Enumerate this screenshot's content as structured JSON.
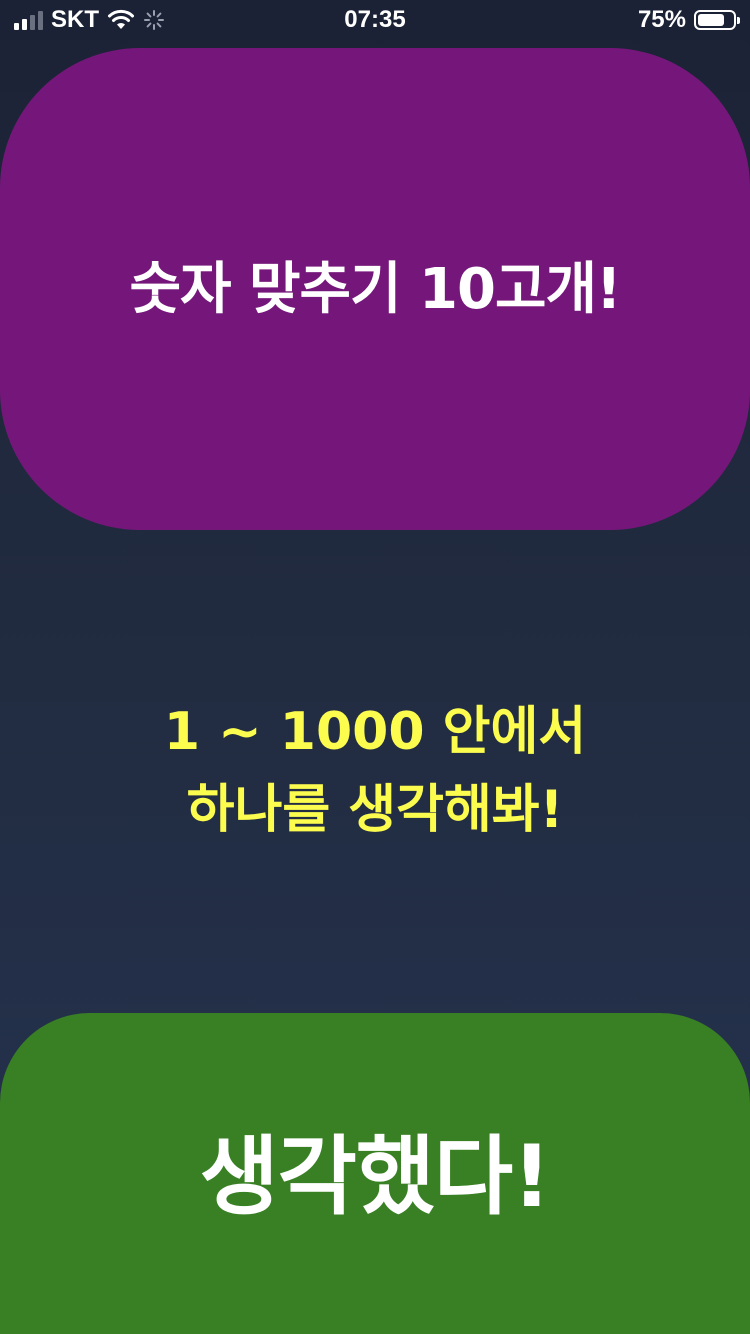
{
  "status_bar": {
    "carrier": "SKT",
    "time": "07:35",
    "battery_percent_text": "75%",
    "battery_level": 0.75,
    "icons": [
      "cellular-signal-icon",
      "wifi-icon",
      "loading-spinner-icon",
      "battery-icon"
    ]
  },
  "title_card": {
    "text": "숫자 맞추기 10고개!",
    "color": "#75177a"
  },
  "instruction": {
    "line1": "1 ~ 1000 안에서",
    "line2": "하나를 생각해봐!",
    "color": "#fcfc4f"
  },
  "confirm_button": {
    "label": "생각했다!",
    "color": "#388023"
  }
}
